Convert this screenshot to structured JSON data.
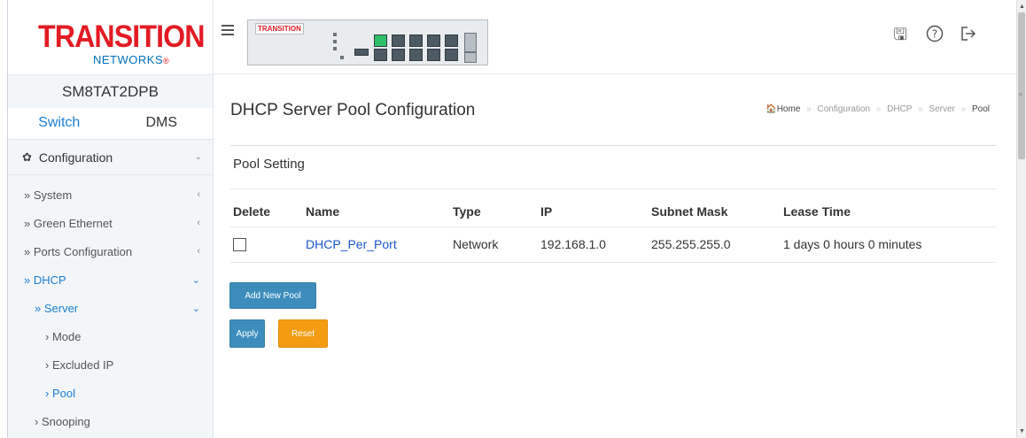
{
  "sidebar": {
    "logo": {
      "main": "TRANSITION",
      "sub": "NETWORKS"
    },
    "model": "SM8TAT2DPB",
    "tabs": [
      {
        "label": "Switch",
        "active": true
      },
      {
        "label": "DMS",
        "active": false
      }
    ],
    "menu_header": {
      "label": "Configuration",
      "icon": "gear-icon"
    },
    "items": [
      {
        "label": "» System"
      },
      {
        "label": "» Green Ethernet"
      },
      {
        "label": "» Ports Configuration"
      },
      {
        "label": "» DHCP"
      },
      {
        "label": "» Server"
      },
      {
        "label": "› Mode"
      },
      {
        "label": "› Excluded IP"
      },
      {
        "label": "› Pool"
      },
      {
        "label": "› Snooping"
      }
    ]
  },
  "topbar": {
    "device_logo": "TRANSITION",
    "icons": [
      "save-icon",
      "help-icon",
      "logout-icon"
    ]
  },
  "main": {
    "title": "DHCP Server Pool Configuration",
    "breadcrumb": [
      "Home",
      "Configuration",
      "DHCP",
      "Server",
      "Pool"
    ],
    "section_title": "Pool Setting",
    "table": {
      "headers": [
        "Delete",
        "Name",
        "Type",
        "IP",
        "Subnet Mask",
        "Lease Time"
      ],
      "rows": [
        {
          "delete": false,
          "name": "DHCP_Per_Port",
          "type": "Network",
          "ip": "192.168.1.0",
          "subnet_mask": "255.255.255.0",
          "lease_time": "1 days 0 hours 0 minutes"
        }
      ]
    },
    "buttons": {
      "add": "Add New Pool",
      "apply": "Apply",
      "reset": "Reset"
    }
  },
  "colors": {
    "accent": "#3c8dbc",
    "link": "#1a54c9",
    "active_menu": "#1a7fd4",
    "reset": "#f39c12",
    "brand_red": "#e31b23",
    "brand_blue": "#0071bc"
  }
}
